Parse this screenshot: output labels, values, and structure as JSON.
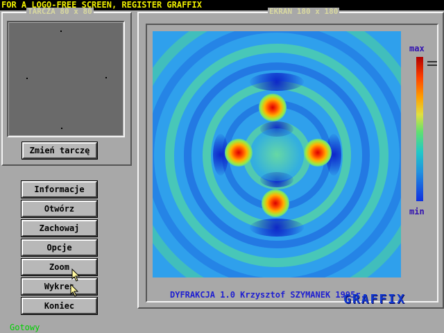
{
  "banner": "FOR A LOGO-FREE SCREEN, REGISTER GRAFFIX",
  "target_panel": {
    "caption": "TARCZA 80 x 80",
    "change_button": "Zmień tarczę"
  },
  "screen_panel": {
    "caption": "EKRAN 180 x 180",
    "legend_max": "max",
    "legend_min": "min",
    "footer": "DYFRAKCJA 1.0 Krzysztof SZYMANEK 1995r.",
    "logo": "GRAFFIX"
  },
  "menu": {
    "info": "Informacje",
    "open": "Otwórz",
    "save": "Zachowaj",
    "options": "Opcje",
    "zoom": "Zoom",
    "chart": "Wykres",
    "exit": "Koniec"
  },
  "status": "Gotowy",
  "colors": {
    "banner_bg": "#000000",
    "banner_text": "#f0f000",
    "panel_bg": "#a8a8a8",
    "title_blue": "#2020d0",
    "status_green": "#00d000"
  },
  "icons": {
    "cursor": "arrow-cursor-icon"
  }
}
